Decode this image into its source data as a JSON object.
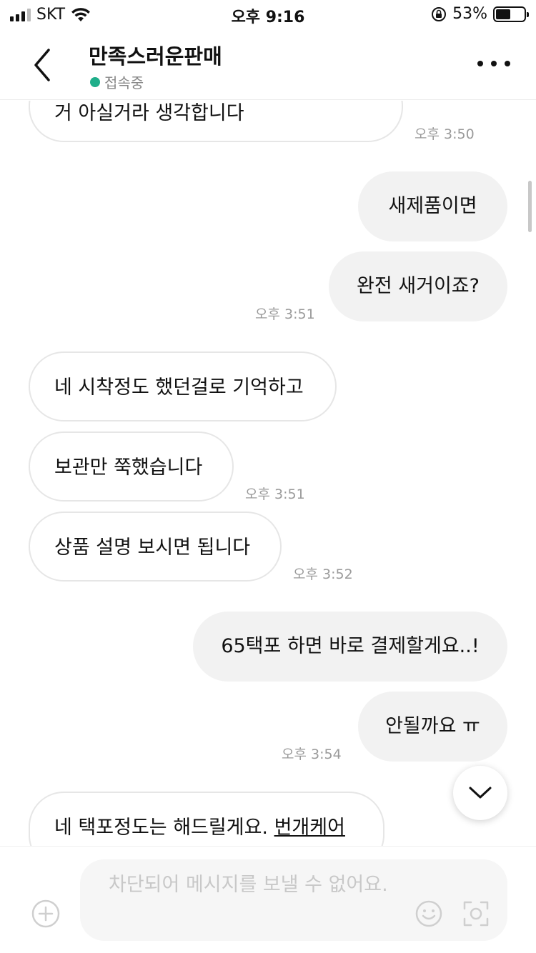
{
  "status_bar": {
    "carrier": "SKT",
    "time": "오후 9:16",
    "battery": "53%",
    "battery_level": 0.53
  },
  "header": {
    "title": "만족스러운판매",
    "presence": "접속중",
    "presence_color": "#1fae8a"
  },
  "messages": [
    {
      "dir": "in",
      "text": "거 아실거라 생각합니다"
    },
    {
      "dir": "time",
      "text": "오후 3:50"
    },
    {
      "dir": "out",
      "text": "새제품이면"
    },
    {
      "dir": "out",
      "text": "완전 새거이죠?"
    },
    {
      "dir": "time",
      "text": "오후 3:51"
    },
    {
      "dir": "in",
      "text": "네 시착정도 했던걸로 기억하고"
    },
    {
      "dir": "in",
      "text": "보관만 쭉했습니다"
    },
    {
      "dir": "time",
      "text": "오후 3:51"
    },
    {
      "dir": "in",
      "text": "상품 설명 보시면 됩니다"
    },
    {
      "dir": "time",
      "text": "오후 3:52"
    },
    {
      "dir": "out",
      "text": "65택포 하면 바로 결제할게요..!"
    },
    {
      "dir": "out",
      "text": "안될까요 ㅠ"
    },
    {
      "dir": "time",
      "text": "오후 3:54"
    },
    {
      "dir": "in",
      "text": "네 택포정도는 해드릴게요. ",
      "link": "번개케어"
    }
  ],
  "input": {
    "placeholder": "차단되어 메시지를 보낼 수 없어요."
  },
  "icons": {
    "back": "chevron-left-icon",
    "more": "more-horizontal-icon",
    "scroll_down": "chevron-down-icon",
    "attach": "plus-circle-icon",
    "emoji": "smile-icon",
    "scan": "scan-icon"
  }
}
